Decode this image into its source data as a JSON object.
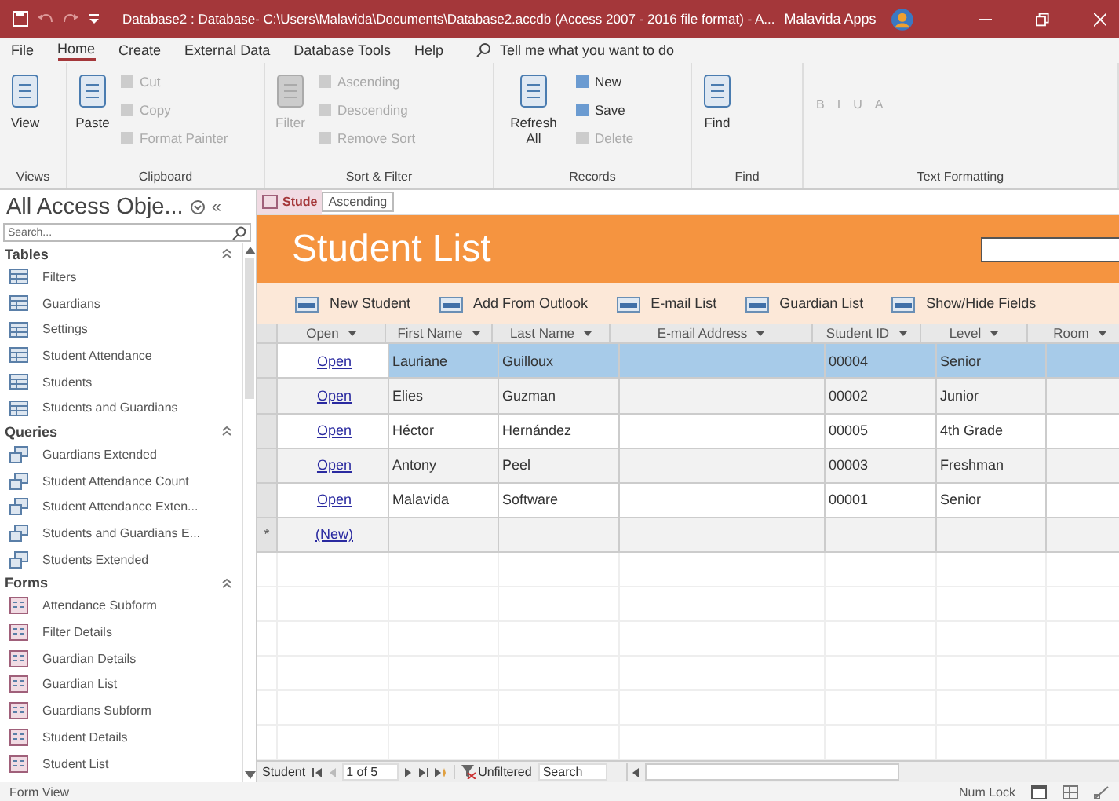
{
  "title_bar": {
    "title": "Database2 : Database- C:\\Users\\Malavida\\Documents\\Database2.accdb (Access 2007 - 2016 file format) - A...",
    "user": "Malavida Apps"
  },
  "menu_tabs": [
    {
      "label": "File",
      "selected": false
    },
    {
      "label": "Home",
      "selected": true
    },
    {
      "label": "Create",
      "selected": false
    },
    {
      "label": "External Data",
      "selected": false
    },
    {
      "label": "Database Tools",
      "selected": false
    },
    {
      "label": "Help",
      "selected": false
    }
  ],
  "tell_me": {
    "placeholder": "Tell me what you want to do"
  },
  "ribbon_groups": [
    {
      "label": "Views",
      "items": [
        {
          "label": "View",
          "kind": "large",
          "disabled": false
        }
      ]
    },
    {
      "label": "Clipboard",
      "items": [
        {
          "label": "Paste",
          "kind": "large",
          "disabled": false
        },
        {
          "label": "Cut",
          "kind": "small",
          "disabled": true
        },
        {
          "label": "Copy",
          "kind": "small",
          "disabled": true
        },
        {
          "label": "Format Painter",
          "kind": "small",
          "disabled": true
        }
      ]
    },
    {
      "label": "Sort & Filter",
      "items": [
        {
          "label": "Filter",
          "kind": "large",
          "disabled": true
        },
        {
          "label": "Ascending",
          "kind": "small",
          "disabled": true
        },
        {
          "label": "Descending",
          "kind": "small",
          "disabled": true
        },
        {
          "label": "Remove Sort",
          "kind": "small",
          "disabled": true
        }
      ]
    },
    {
      "label": "Records",
      "items": [
        {
          "label": "Refresh All",
          "kind": "large",
          "disabled": false
        },
        {
          "label": "New",
          "kind": "small",
          "disabled": false
        },
        {
          "label": "Save",
          "kind": "small",
          "disabled": false
        },
        {
          "label": "Delete",
          "kind": "small",
          "disabled": true
        }
      ]
    },
    {
      "label": "Find",
      "items": [
        {
          "label": "Find",
          "kind": "large",
          "disabled": false
        }
      ]
    },
    {
      "label": "Text Formatting",
      "items": [
        {
          "label": "B",
          "kind": "format",
          "disabled": true
        },
        {
          "label": "I",
          "kind": "format",
          "disabled": true
        },
        {
          "label": "U",
          "kind": "format",
          "disabled": true
        },
        {
          "label": "A",
          "kind": "format",
          "disabled": true
        }
      ]
    }
  ],
  "nav_pane": {
    "title": "All Access Obje...",
    "collapse": "«",
    "search_placeholder": "Search...",
    "groups": [
      {
        "label": "Tables",
        "items": [
          {
            "label": "Filters",
            "kind": "table"
          },
          {
            "label": "Guardians",
            "kind": "table"
          },
          {
            "label": "Settings",
            "kind": "table"
          },
          {
            "label": "Student Attendance",
            "kind": "table"
          },
          {
            "label": "Students",
            "kind": "table"
          },
          {
            "label": "Students and Guardians",
            "kind": "table"
          }
        ]
      },
      {
        "label": "Queries",
        "items": [
          {
            "label": "Guardians Extended",
            "kind": "query"
          },
          {
            "label": "Student Attendance Count",
            "kind": "query"
          },
          {
            "label": "Student Attendance Exten...",
            "kind": "query"
          },
          {
            "label": "Students and Guardians E...",
            "kind": "query"
          },
          {
            "label": "Students Extended",
            "kind": "query"
          }
        ]
      },
      {
        "label": "Forms",
        "items": [
          {
            "label": "Attendance Subform",
            "kind": "form"
          },
          {
            "label": "Filter Details",
            "kind": "form"
          },
          {
            "label": "Guardian Details",
            "kind": "form"
          },
          {
            "label": "Guardian List",
            "kind": "form"
          },
          {
            "label": "Guardians Subform",
            "kind": "form"
          },
          {
            "label": "Student Details",
            "kind": "form"
          },
          {
            "label": "Student List",
            "kind": "form"
          }
        ]
      }
    ]
  },
  "document_tab": {
    "label": "Stude",
    "tooltip": "Ascending"
  },
  "form": {
    "title": "Student List",
    "actions": [
      "New Student",
      "Add From Outlook",
      "E-mail List",
      "Guardian List",
      "Show/Hide Fields"
    ],
    "columns": [
      "Open",
      "First Name",
      "Last Name",
      "E-mail Address",
      "Student ID",
      "Level",
      "Room"
    ],
    "rows": [
      {
        "selected": true,
        "cells": [
          "Open",
          "Lauriane",
          "Guilloux",
          "",
          "00004",
          "Senior",
          ""
        ]
      },
      {
        "selected": false,
        "cells": [
          "Open",
          "Elies",
          "Guzman",
          "",
          "00002",
          "Junior",
          ""
        ]
      },
      {
        "selected": false,
        "cells": [
          "Open",
          "Héctor",
          "Hernández",
          "",
          "00005",
          "4th Grade",
          ""
        ]
      },
      {
        "selected": false,
        "cells": [
          "Open",
          "Antony",
          "Peel",
          "",
          "00003",
          "Freshman",
          ""
        ]
      },
      {
        "selected": false,
        "cells": [
          "Open",
          "Malavida",
          "Software",
          "",
          "00001",
          "Senior",
          ""
        ]
      }
    ],
    "new_row": {
      "marker": "*",
      "link": "(New)"
    }
  },
  "record_nav": {
    "label": "Student",
    "position": "1 of 5",
    "filter": "Unfiltered",
    "search": "Search"
  },
  "status_bar": {
    "left": "Form View",
    "right": "Num Lock"
  }
}
